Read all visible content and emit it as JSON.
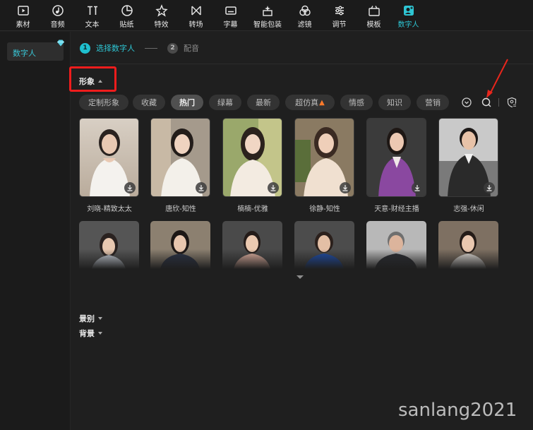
{
  "toolbar": {
    "items": [
      {
        "label": "素材",
        "icon": "media-icon"
      },
      {
        "label": "音频",
        "icon": "audio-icon"
      },
      {
        "label": "文本",
        "icon": "text-icon"
      },
      {
        "label": "贴纸",
        "icon": "sticker-icon"
      },
      {
        "label": "特效",
        "icon": "effects-icon"
      },
      {
        "label": "转场",
        "icon": "transition-icon"
      },
      {
        "label": "字幕",
        "icon": "subtitle-icon"
      },
      {
        "label": "智能包装",
        "icon": "smart-package-icon"
      },
      {
        "label": "滤镜",
        "icon": "filter-icon"
      },
      {
        "label": "调节",
        "icon": "adjust-icon"
      },
      {
        "label": "模板",
        "icon": "template-icon"
      },
      {
        "label": "数字人",
        "icon": "digital-human-icon",
        "active": true
      }
    ]
  },
  "sidebar": {
    "item": "数字人",
    "badge_icon": "diamond-icon"
  },
  "steps": [
    {
      "num": "1",
      "label": "选择数字人"
    },
    {
      "num": "2",
      "label": "配音"
    }
  ],
  "sections": {
    "appearance": "形象",
    "scene": "景别",
    "background": "背景"
  },
  "filters": [
    "定制形象",
    "收藏",
    "热门",
    "绿幕",
    "最新",
    "超仿真",
    "情感",
    "知识",
    "营销"
  ],
  "selected_filter": "热门",
  "avatars_row1": [
    "刘晓-精致太太",
    "唐欣-知性",
    "楠楠-优雅",
    "徐静-知性",
    "天意-财经主播",
    "志强-休闲"
  ],
  "watermark": "sanlang2021",
  "colors": {
    "accent": "#2ec5d3",
    "highlight_box": "#ef1c1c",
    "arrow": "#e8261c"
  }
}
